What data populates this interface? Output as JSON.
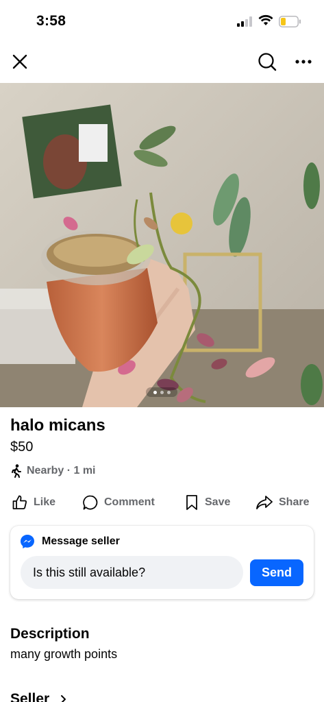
{
  "status_bar": {
    "time": "3:58",
    "icons": [
      "cellular-signal-icon",
      "wifi-icon",
      "battery-low-icon"
    ],
    "battery_color": "#f5c518"
  },
  "nav": {
    "close_icon": "close-icon",
    "search_icon": "search-icon",
    "more_icon": "more-icon"
  },
  "photo": {
    "description_icon": "listing-photo",
    "carousel_count": 3,
    "carousel_active_index": 0
  },
  "listing": {
    "title": "halo micans",
    "price": "$50",
    "location": "Nearby · 1 mi",
    "location_icon": "walking-person-icon"
  },
  "actions": {
    "like": "Like",
    "comment": "Comment",
    "save": "Save",
    "share": "Share"
  },
  "message": {
    "header": "Message seller",
    "header_icon": "messenger-icon",
    "input_value": "Is this still available?",
    "send_label": "Send",
    "accent_color": "#0866ff"
  },
  "description": {
    "title": "Description",
    "text": "many growth points"
  },
  "seller": {
    "title": "Seller",
    "chevron_icon": "chevron-right-icon"
  }
}
